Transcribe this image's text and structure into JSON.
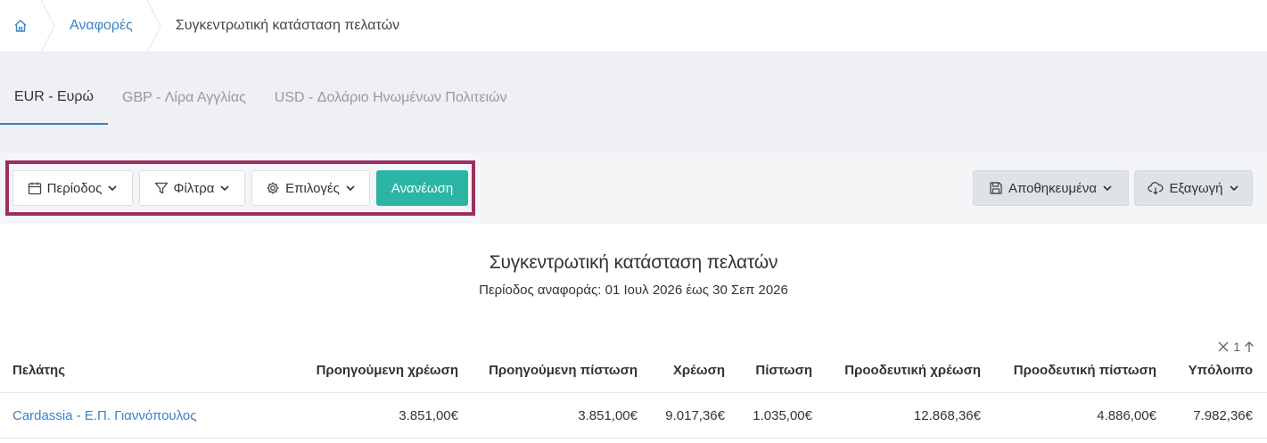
{
  "breadcrumb": {
    "home_icon": "home-icon",
    "items": [
      {
        "label": "Αναφορές",
        "link": true
      },
      {
        "label": "Συγκεντρωτική κατάσταση πελατών",
        "link": false
      }
    ]
  },
  "tabs": [
    {
      "label": "EUR - Ευρώ",
      "active": true
    },
    {
      "label": "GBP - Λίρα Αγγλίας",
      "active": false
    },
    {
      "label": "USD - Δολάριο Ηνωμένων Πολιτειών",
      "active": false
    }
  ],
  "toolbar": {
    "period_label": "Περίοδος",
    "filters_label": "Φίλτρα",
    "options_label": "Επιλογές",
    "refresh_label": "Ανανέωση",
    "saved_label": "Αποθηκευμένα",
    "export_label": "Εξαγωγή"
  },
  "report": {
    "title": "Συγκεντρωτική κατάσταση πελατών",
    "subtitle": "Περίοδος αναφοράς: 01 Ιουλ 2026 έως 30 Σεπ 2026"
  },
  "sort": {
    "index": "1"
  },
  "table": {
    "columns": [
      "Πελάτης",
      "Προηγούμενη χρέωση",
      "Προηγούμενη πίστωση",
      "Χρέωση",
      "Πίστωση",
      "Προοδευτική χρέωση",
      "Προοδευτική πίστωση",
      "Υπόλοιπο"
    ],
    "rows": [
      {
        "customer": "Cardassia - Ε.Π. Γιαννόπουλος",
        "prev_debit": "3.851,00€",
        "prev_credit": "3.851,00€",
        "debit": "9.017,36€",
        "credit": "1.035,00€",
        "prog_debit": "12.868,36€",
        "prog_credit": "4.886,00€",
        "balance": "7.982,36€"
      }
    ]
  },
  "colors": {
    "accent": "#3b82c4",
    "teal": "#2bb5a5",
    "highlight": "#9c2f5f"
  }
}
